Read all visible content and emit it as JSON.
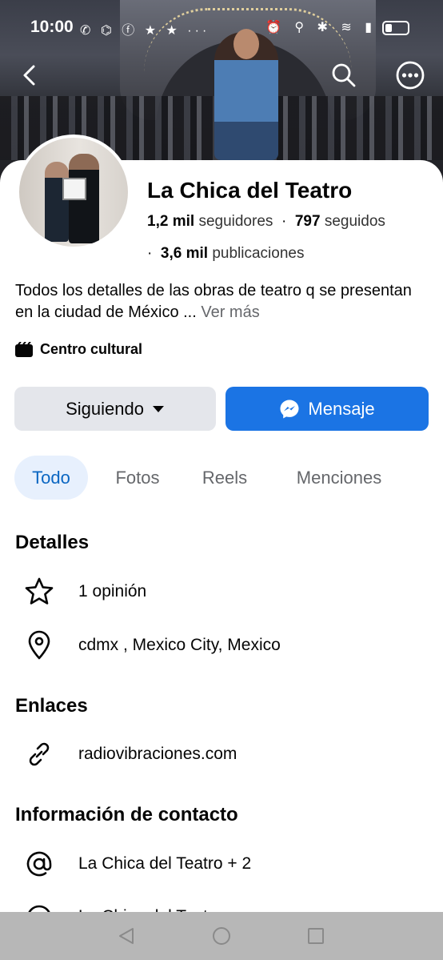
{
  "status_bar": {
    "time": "10:00",
    "app_icons": "✆ ⌬ ⓕ ★ ★ ···",
    "system_icons": "⏰ ⚲ ✱ ≋ ▮"
  },
  "page": {
    "name": "La Chica del Teatro",
    "followers_count": "1,2 mil",
    "followers_label": "seguidores",
    "following_count": "797",
    "following_label": "seguidos",
    "posts_count": "3,6 mil",
    "posts_label": "publicaciones",
    "bio": "Todos los detalles de las obras de teatro q se presentan en la ciudad de México ...",
    "bio_more": "Ver más",
    "category": "Centro cultural"
  },
  "actions": {
    "following_label": "Siguiendo",
    "message_label": "Mensaje"
  },
  "tabs": [
    {
      "label": "Todo",
      "active": true
    },
    {
      "label": "Fotos",
      "active": false
    },
    {
      "label": "Reels",
      "active": false
    },
    {
      "label": "Menciones",
      "active": false
    }
  ],
  "details": {
    "title": "Detalles",
    "rating": "1 opinión",
    "location": "cdmx , Mexico City, Mexico"
  },
  "links": {
    "title": "Enlaces",
    "website": "radiovibraciones.com"
  },
  "contact": {
    "title": "Información de contacto",
    "handle": "La Chica del Teatro + 2",
    "partial": "La Chica del Teatro"
  },
  "colors": {
    "accent": "#1b74e4",
    "tab_active_bg": "#e7f0fd",
    "tab_active_text": "#0a66c2",
    "muted_text": "#65676b",
    "button_gray": "#e4e6eb"
  },
  "icons": {
    "back": "chevron-left-icon",
    "search": "search-icon",
    "more": "more-icon",
    "category": "clapperboard-icon",
    "dropdown": "caret-down-icon",
    "messenger": "messenger-icon",
    "rating": "star-icon",
    "location": "location-pin-icon",
    "link": "link-icon",
    "contact": "at-sign-icon"
  }
}
